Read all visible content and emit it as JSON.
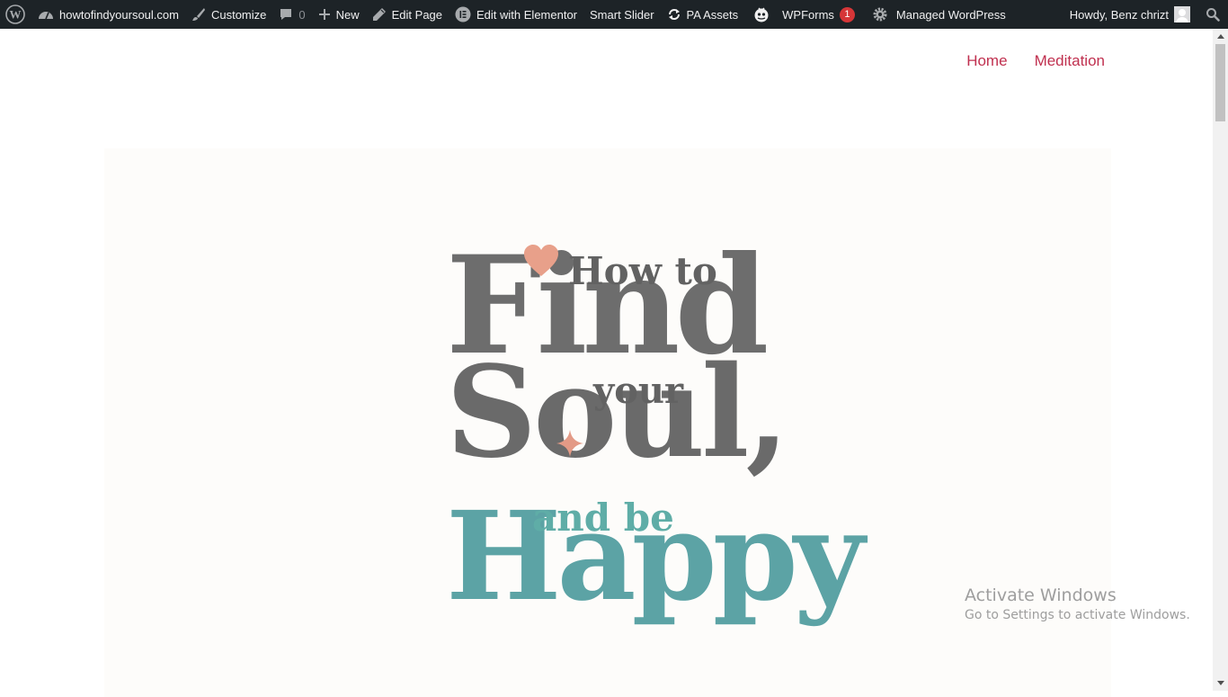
{
  "adminbar": {
    "site_name": "howtofindyoursoul.com",
    "customize": "Customize",
    "comments_count": "0",
    "new": "New",
    "edit_page": "Edit Page",
    "edit_elementor": "Edit with Elementor",
    "smart_slider": "Smart Slider",
    "pa_assets": "PA Assets",
    "wpforms": "WPForms",
    "wpforms_badge": "1",
    "managed_wp": "Managed WordPress",
    "howdy": "Howdy, Benz chrizt",
    "icons": [
      "wordpress-icon",
      "dashboard-icon",
      "brush-icon",
      "comment-icon",
      "plus-icon",
      "pencil-icon",
      "elementor-icon",
      "sync-icon",
      "wpforms-icon",
      "gear-icon",
      "avatar",
      "search-icon"
    ]
  },
  "nav": {
    "items": [
      "Home",
      "Meditation"
    ]
  },
  "logo": {
    "line1": "How to",
    "line2": "Find",
    "line3": "your",
    "line4": "Soul,",
    "line5": "and be",
    "line6": "Happy"
  },
  "watermark": {
    "title": "Activate Windows",
    "subtitle": "Go to Settings to activate Windows."
  },
  "colors": {
    "adminbar_bg": "#1d2327",
    "nav_link": "#c0304f",
    "logo_gray": "#6a6a6a",
    "logo_teal": "#5ca3a5",
    "heart": "#e8a08a",
    "badge": "#d63638"
  }
}
